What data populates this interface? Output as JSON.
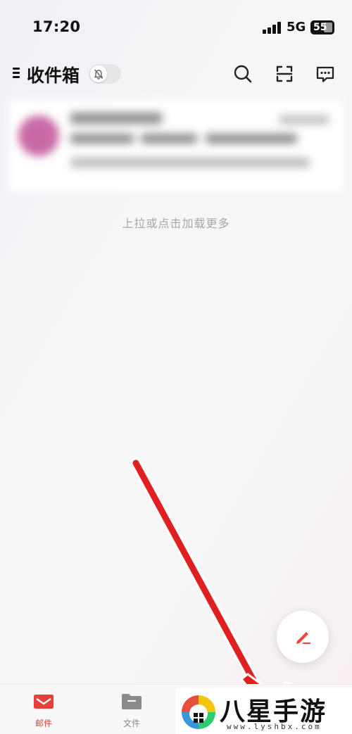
{
  "status_bar": {
    "time": "17:20",
    "network": "5G",
    "battery": "55"
  },
  "header": {
    "title": "收件箱",
    "icons": [
      "menu-icon",
      "mute-bell-icon",
      "search-icon",
      "scan-icon",
      "chat-icon"
    ]
  },
  "inbox": {
    "load_more": "上拉或点击加载更多"
  },
  "compose": {
    "icon": "pencil-icon",
    "accent": "#e54b3c"
  },
  "bottom_nav": {
    "tabs": [
      {
        "label": "邮件",
        "icon": "mail-icon",
        "active": true
      },
      {
        "label": "文件",
        "icon": "folder-icon",
        "active": false
      }
    ]
  },
  "watermark": {
    "title": "八星手游网",
    "url": "www.lyshbx.com"
  },
  "colors": {
    "accent": "#e5403a",
    "arrow": "#e02020",
    "inactive": "#8a8a8a"
  }
}
